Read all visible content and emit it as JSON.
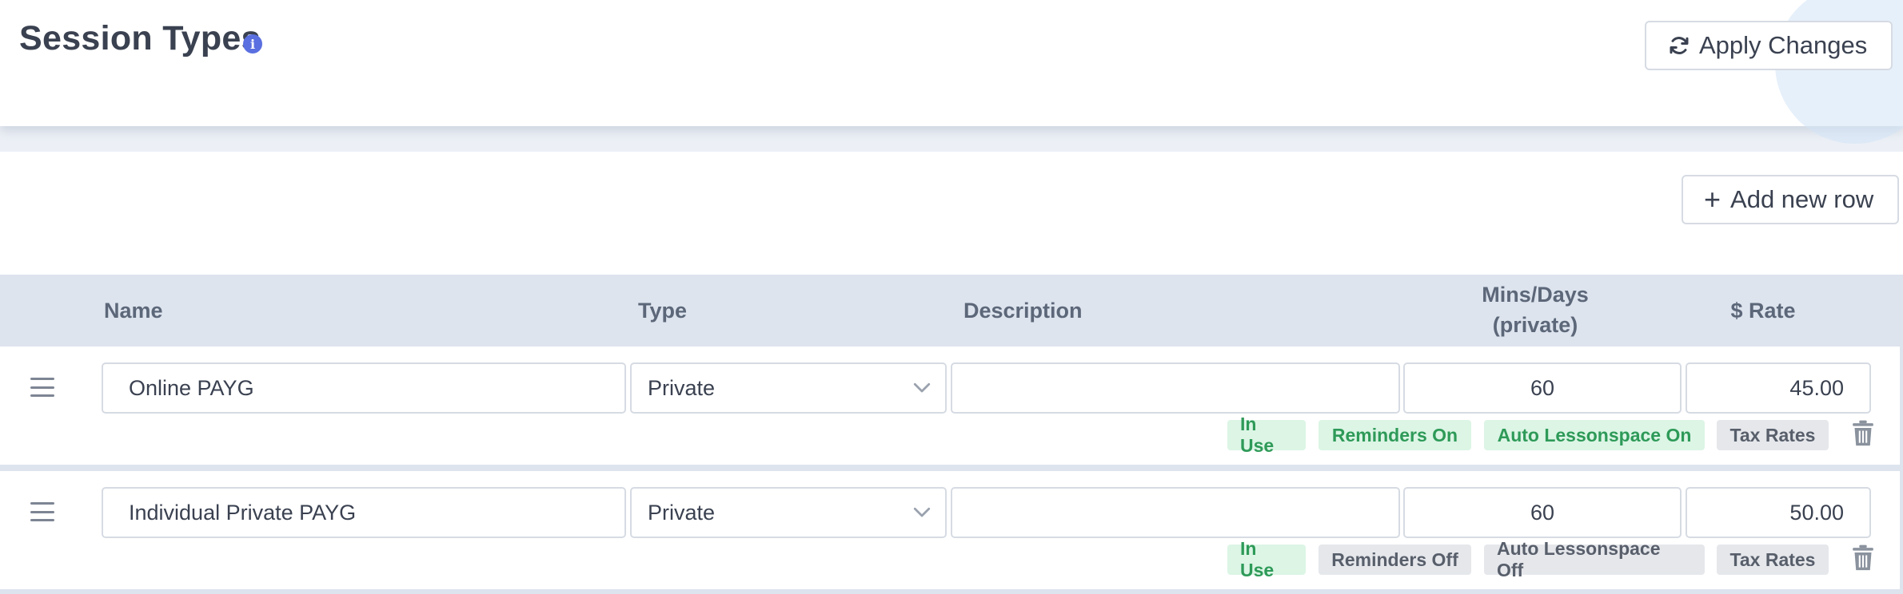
{
  "header": {
    "title": "Session Types",
    "info_icon": "info-icon",
    "apply_label": "Apply Changes",
    "apply_icon": "refresh-icon"
  },
  "toolbar": {
    "add_row_label": "Add new row",
    "add_icon": "plus-icon"
  },
  "table": {
    "columns": {
      "name": "Name",
      "type": "Type",
      "description": "Description",
      "mins_line1": "Mins/Days",
      "mins_line2": "(private)",
      "rate": "$ Rate"
    },
    "rows": [
      {
        "name": "Online PAYG",
        "type": "Private",
        "description": "",
        "mins": "60",
        "rate": "45.00",
        "badges": {
          "in_use": "In Use",
          "reminders": "Reminders On",
          "lessonspace": "Auto Lessonspace On",
          "tax": "Tax Rates"
        }
      },
      {
        "name": "Individual Private PAYG",
        "type": "Private",
        "description": "",
        "mins": "60",
        "rate": "50.00",
        "badges": {
          "in_use": "In Use",
          "reminders": "Reminders Off",
          "lessonspace": "Auto Lessonspace Off",
          "tax": "Tax Rates"
        }
      }
    ]
  },
  "colors": {
    "accent": "#5a6fe0",
    "badge_green_bg": "#dcf5e5",
    "badge_green_text": "#2e9a58",
    "badge_gray_bg": "#e5e7eb",
    "header_row_bg": "#dde4ee"
  }
}
